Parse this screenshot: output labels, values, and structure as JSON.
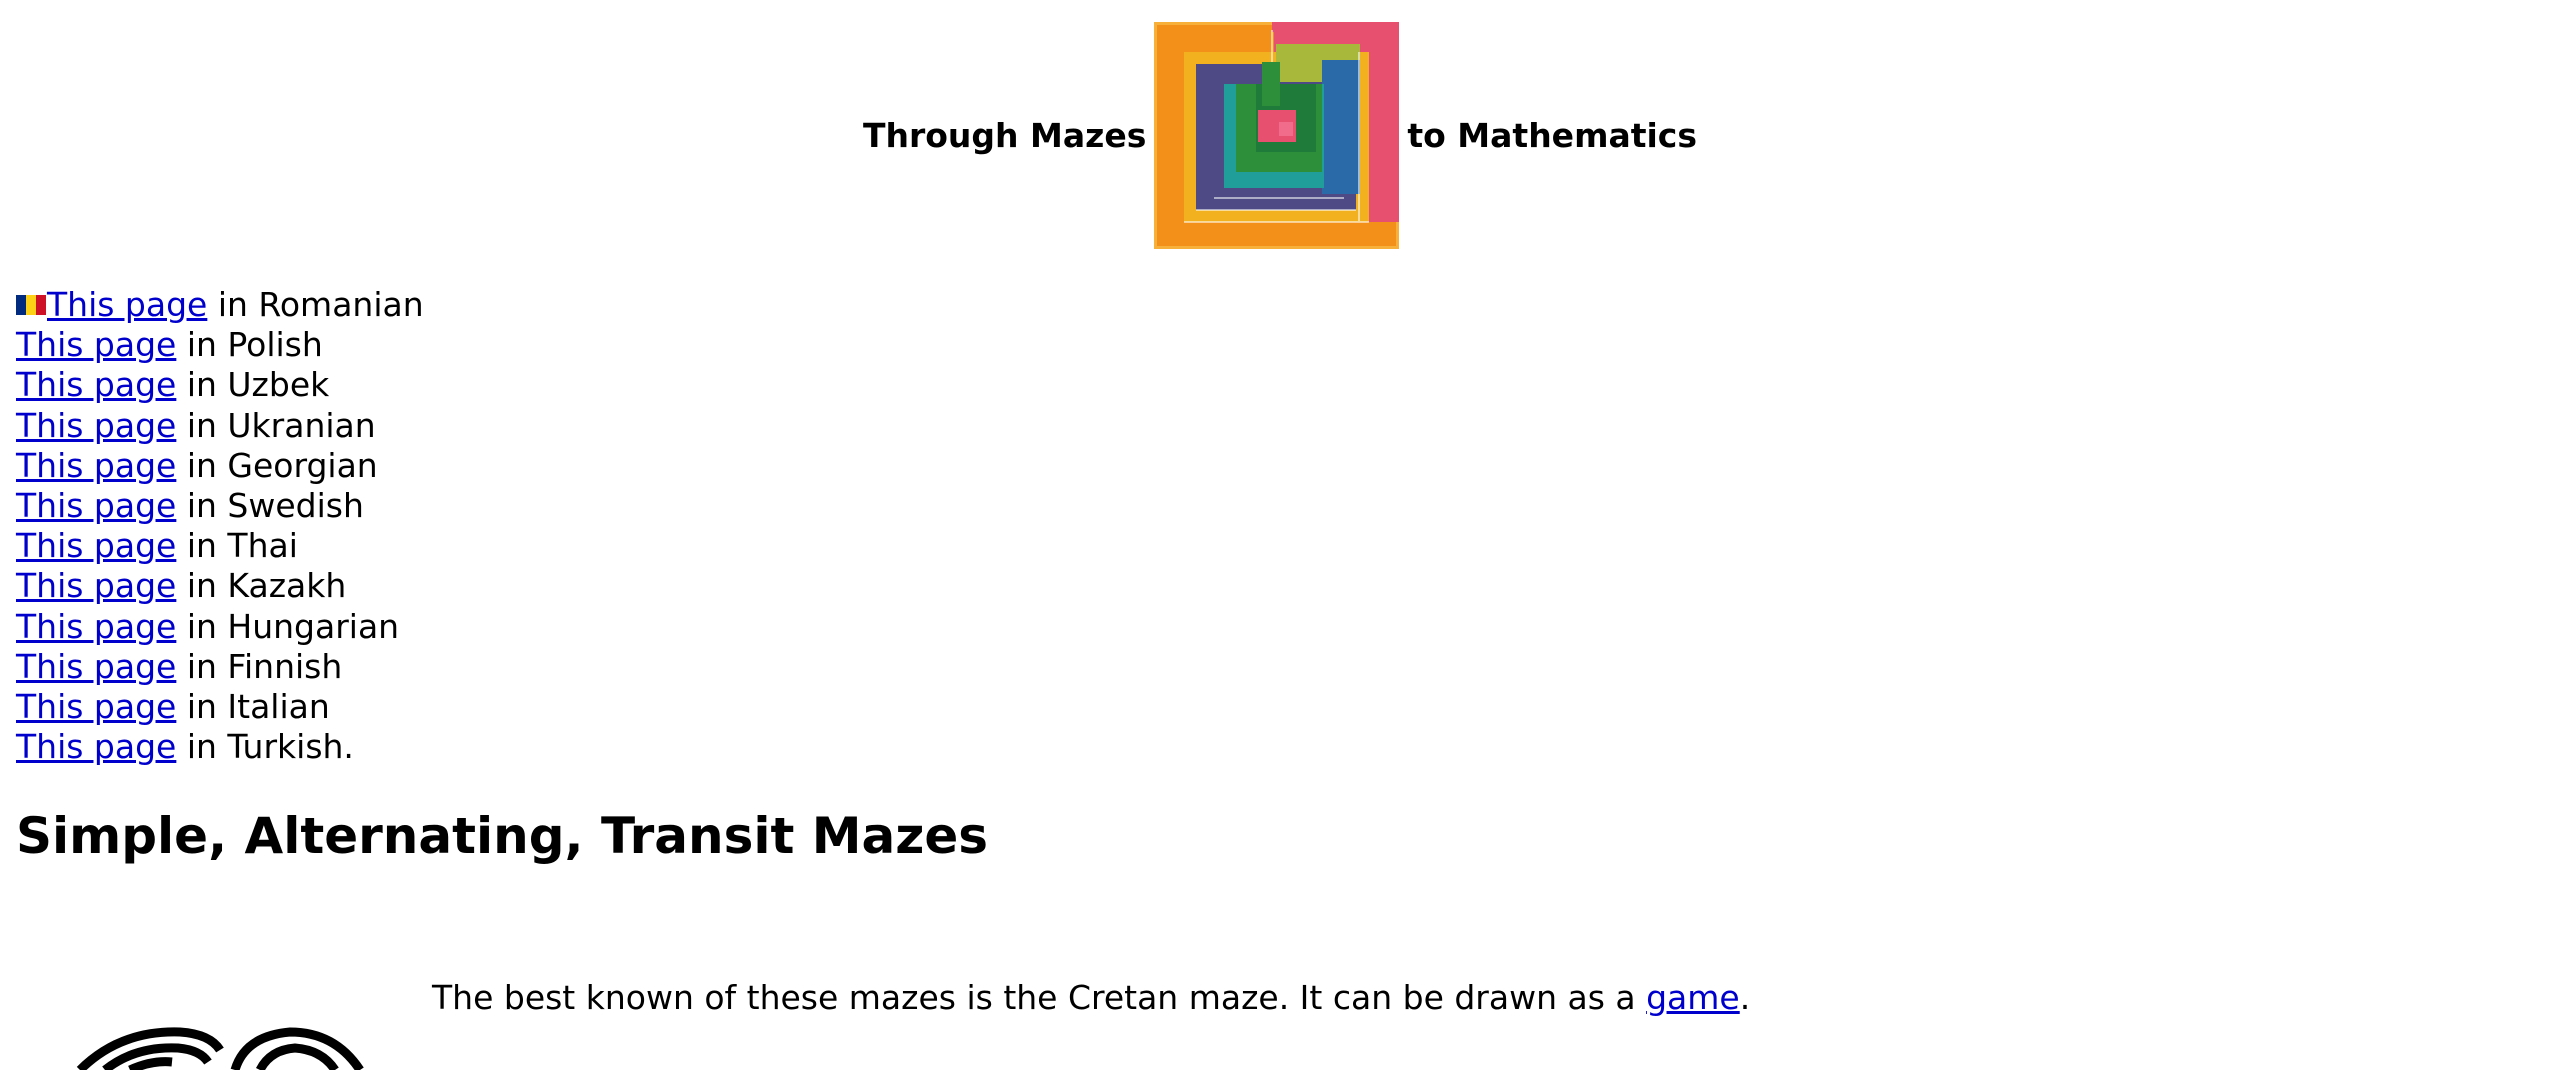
{
  "header": {
    "title_left": "Through Mazes",
    "title_right": "to Mathematics",
    "logo_icon": "colored-maze-logo-icon"
  },
  "languages": [
    {
      "link": "This page",
      "text": " in Romanian",
      "flag": "romania-flag-icon"
    },
    {
      "link": "This page",
      "text": " in Polish"
    },
    {
      "link": "This page",
      "text": " in Uzbek"
    },
    {
      "link": "This page",
      "text": " in Ukranian"
    },
    {
      "link": "This page",
      "text": " in Georgian"
    },
    {
      "link": "This page",
      "text": " in Swedish"
    },
    {
      "link": "This page",
      "text": " in Thai"
    },
    {
      "link": "This page",
      "text": " in Kazakh"
    },
    {
      "link": "This page",
      "text": " in Hungarian"
    },
    {
      "link": "This page",
      "text": " in Finnish"
    },
    {
      "link": "This page",
      "text": " in Italian"
    },
    {
      "link": "This page",
      "text": " in Turkish."
    }
  ],
  "section": {
    "heading": "Simple, Alternating, Transit Mazes",
    "intro_text": "The best known of these mazes is the Cretan maze. It can be drawn as a ",
    "intro_link": "game",
    "intro_end": ".",
    "figure_icon": "cretan-maze-icon"
  },
  "colors": {
    "link": "#0000cc",
    "logo_orange": "#f39019",
    "logo_pink": "#e8506f",
    "logo_purple": "#4d4a86",
    "logo_green": "#2e8f3a",
    "logo_teal": "#1f9e9a",
    "logo_yellowgreen": "#a7b83a",
    "flag_blue": "#002b7f",
    "flag_yellow": "#fcd116",
    "flag_red": "#ce1126"
  }
}
